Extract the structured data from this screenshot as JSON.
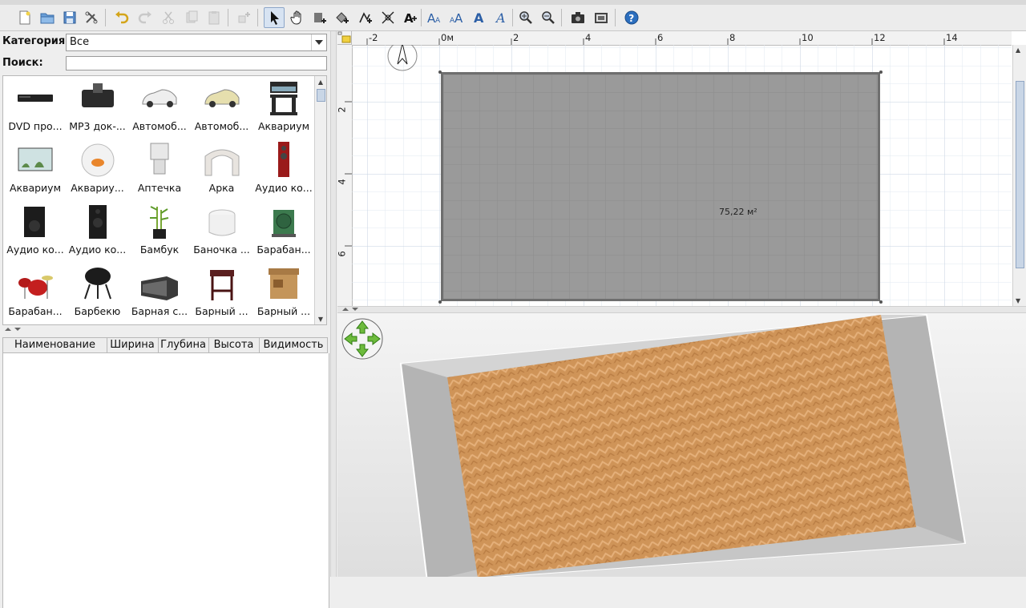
{
  "toolbar": {
    "buttons": [
      {
        "name": "new-home-icon"
      },
      {
        "name": "open-icon"
      },
      {
        "name": "save-icon"
      },
      {
        "name": "preferences-icon"
      },
      {
        "name": "undo-icon"
      },
      {
        "name": "redo-icon"
      },
      {
        "name": "cut-icon"
      },
      {
        "name": "copy-icon"
      },
      {
        "name": "paste-icon"
      },
      {
        "name": "add-furniture-icon"
      },
      {
        "name": "select-mode-icon",
        "active": true
      },
      {
        "name": "pan-mode-icon"
      },
      {
        "name": "create-walls-icon"
      },
      {
        "name": "create-rooms-icon"
      },
      {
        "name": "create-polylines-icon"
      },
      {
        "name": "create-dimensions-icon"
      },
      {
        "name": "add-text-icon"
      },
      {
        "name": "increase-text-icon"
      },
      {
        "name": "decrease-text-icon"
      },
      {
        "name": "bold-text-icon"
      },
      {
        "name": "italic-text-icon"
      },
      {
        "name": "zoom-in-icon"
      },
      {
        "name": "zoom-out-icon"
      },
      {
        "name": "create-photo-icon"
      },
      {
        "name": "create-video-icon"
      },
      {
        "name": "help-icon"
      }
    ]
  },
  "catalog": {
    "category_label": "Категория",
    "category_value": "Все",
    "search_label": "Поиск:",
    "search_value": "",
    "items": [
      {
        "label": "DVD про...",
        "icon": "dvd-player-icon"
      },
      {
        "label": "MP3 док-...",
        "icon": "mp3-dock-icon"
      },
      {
        "label": "Автомоб...",
        "icon": "car-white-icon"
      },
      {
        "label": "Автомоб...",
        "icon": "car-beige-icon"
      },
      {
        "label": "Аквариум",
        "icon": "aquarium-stand-icon"
      },
      {
        "label": "Аквариум",
        "icon": "aquarium-icon"
      },
      {
        "label": "Аквариу...",
        "icon": "fishbowl-icon"
      },
      {
        "label": "Аптечка",
        "icon": "medicine-cabinet-icon"
      },
      {
        "label": "Арка",
        "icon": "arch-icon"
      },
      {
        "label": "Аудио ко...",
        "icon": "speaker-red-icon"
      },
      {
        "label": "Аудио ко...",
        "icon": "speaker-black-icon"
      },
      {
        "label": "Аудио ко...",
        "icon": "speaker-tall-icon"
      },
      {
        "label": "Бамбук",
        "icon": "bamboo-icon"
      },
      {
        "label": "Баночка ...",
        "icon": "jar-icon"
      },
      {
        "label": "Барабан...",
        "icon": "hose-reel-icon"
      },
      {
        "label": "Барабан...",
        "icon": "drum-kit-icon"
      },
      {
        "label": "Барбекю",
        "icon": "barbecue-icon"
      },
      {
        "label": "Барная с...",
        "icon": "bar-counter-icon"
      },
      {
        "label": "Барный ...",
        "icon": "bar-stool-icon"
      },
      {
        "label": "Барный ...",
        "icon": "bar-cabinet-icon"
      }
    ]
  },
  "furniture_table": {
    "columns": [
      "Наименование",
      "Ширина",
      "Глубина",
      "Высота",
      "Видимость"
    ]
  },
  "plan": {
    "h_ruler": [
      "-2",
      "0м",
      "2",
      "4",
      "6",
      "8",
      "10",
      "12",
      "14"
    ],
    "v_ruler": [
      "2",
      "4",
      "6"
    ],
    "room_area": "75,22 м²"
  },
  "colors": {
    "room_fill": "#9a9a9a",
    "floor": "#cf9458",
    "wall": "#b4b4b4",
    "selection": "#d7e3f2"
  }
}
